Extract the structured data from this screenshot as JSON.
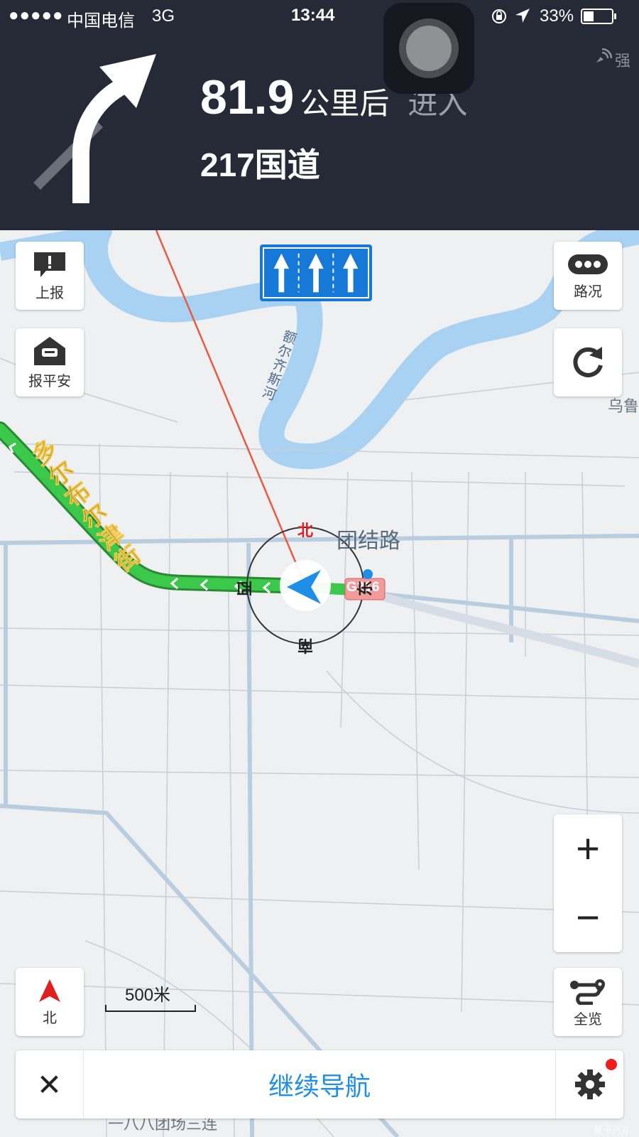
{
  "status_bar": {
    "signal": "●●●●●",
    "carrier": "中国电信",
    "network": "3G",
    "time": "13:44",
    "battery": "33%"
  },
  "gps_signal": "强",
  "guidance": {
    "distance_value": "81.9",
    "distance_unit": "公里后",
    "action": "进入",
    "road": "217国道"
  },
  "map": {
    "river_label": "额尔齐斯河",
    "street_label_vertical": "多尔布尔津街",
    "road_label_east": "团结路",
    "partial_label_right": "乌鲁",
    "highway_shield": "G216",
    "bottom_label": "一八八团场三连",
    "compass": {
      "north": "北",
      "south": "南",
      "west": "西",
      "east": "东"
    }
  },
  "controls": {
    "report_label": "上报",
    "safe_label": "报平安",
    "traffic_label": "路况",
    "north_label": "北",
    "overview_label": "全览",
    "zoom_in": "+",
    "zoom_out": "−",
    "scale": "500米"
  },
  "bottom_bar": {
    "close": "✕",
    "continue_label": "继续导航"
  },
  "colors": {
    "panel_bg": "#252a36",
    "route_green": "#3cc84a",
    "accent_blue": "#1f8ee6",
    "lane_sign_blue": "#1679d8",
    "river_blue": "#a9d2f2",
    "alert_red": "#f01d1d"
  },
  "watermark": "爱卡汽车"
}
